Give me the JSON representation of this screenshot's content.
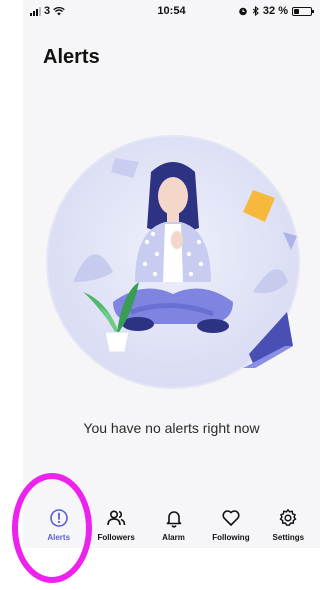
{
  "status_bar": {
    "carrier": "3",
    "time": "10:54",
    "battery_text": "32 %",
    "battery_level": 0.32
  },
  "header": {
    "title": "Alerts"
  },
  "empty_state": {
    "message": "You have no alerts right now"
  },
  "tab_bar": {
    "tabs": [
      {
        "label": "Alerts",
        "icon": "alert-circle-icon",
        "active": true
      },
      {
        "label": "Followers",
        "icon": "users-icon",
        "active": false
      },
      {
        "label": "Alarm",
        "icon": "bell-icon",
        "active": false
      },
      {
        "label": "Following",
        "icon": "heart-icon",
        "active": false
      },
      {
        "label": "Settings",
        "icon": "gear-icon",
        "active": false
      }
    ]
  },
  "colors": {
    "accent": "#5b5fd6",
    "highlight": "#ee22ee",
    "background": "#f6f6f8"
  }
}
